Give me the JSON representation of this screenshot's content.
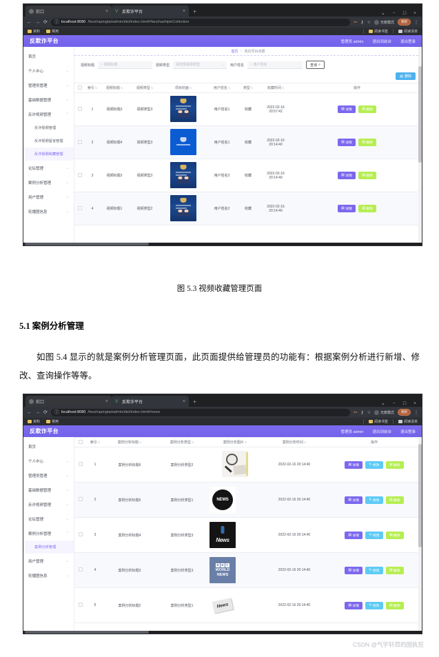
{
  "document": {
    "figure_caption_1": "图 5.3 视频收藏管理页面",
    "section_heading": "5.1 案例分析管理",
    "paragraph": "如图 5.4 显示的就是案例分析管理页面，此页面提供给管理员的功能有：根据案例分析进行新增、修改、查询操作等等。",
    "watermark": "CSDN @气宇轩昂的固执狂"
  },
  "browser": {
    "tabs": [
      {
        "label": "前口",
        "close": "×"
      },
      {
        "label": "反欺诈平台",
        "close": "×"
      }
    ],
    "new_tab": "+",
    "window_controls": {
      "minimize": "−",
      "maximize": "□",
      "close": "×",
      "chevron": "⌄"
    },
    "nav": {
      "back": "←",
      "forward": "→",
      "reload": "⟳",
      "info": "ⓘ"
    },
    "omni_right": {
      "star": "☆",
      "key": "⚷",
      "ext": "⚯",
      "incognito_label": "无痕模式",
      "update_label": "更新",
      "menu": "⋮"
    },
    "bookmarks": {
      "items": [
        "资料",
        "常用"
      ],
      "right_items": [
        "阅读书签",
        "阅读清单"
      ]
    }
  },
  "page1": {
    "url_host": "localhost:8080",
    "url_path": "/fanzhapingtai/admin/dist/index.html#/fanzhashipinCollection",
    "tab_title": "反欺诈平台",
    "header": {
      "logo": "反欺诈平台",
      "user": "管理员 admin",
      "to_front": "退出到前台",
      "logout": "退出登录"
    },
    "breadcrumb": {
      "home": "首页",
      "sep": "⌂",
      "current": "我的项目收藏"
    },
    "sidebar": [
      {
        "label": "首页",
        "expandable": false
      },
      {
        "label": "个人中心",
        "expandable": true
      },
      {
        "label": "管理员管理",
        "expandable": true
      },
      {
        "label": "基础数据管理",
        "expandable": true
      },
      {
        "label": "反诈视频管理",
        "expandable": true,
        "expanded": true,
        "children": [
          {
            "label": "反诈视频管理",
            "active": false
          },
          {
            "label": "反诈视频留言管理",
            "active": false
          },
          {
            "label": "反诈视频收藏管理",
            "active": true
          }
        ]
      },
      {
        "label": "论坛管理",
        "expandable": true
      },
      {
        "label": "案例分析管理",
        "expandable": true
      },
      {
        "label": "用户管理",
        "expandable": true
      },
      {
        "label": "轮播图信息",
        "expandable": true
      }
    ],
    "search": {
      "title_label": "视频标题",
      "title_placeholder": "视频标题",
      "type_label": "视频类型",
      "type_placeholder": "请选择视频类型",
      "user_label": "用户姓名",
      "user_placeholder": "用户姓名",
      "query_button": "查询"
    },
    "delete_button": "删除",
    "table": {
      "columns": [
        "索引",
        "视频标题",
        "视频类型",
        "项目封面",
        "用户姓名",
        "类型",
        "收藏时间",
        "操作"
      ],
      "rows": [
        {
          "index": "1",
          "title": "视频标题3",
          "type": "视频类型3",
          "cover": "v1",
          "user": "用户姓名1",
          "kind": "收藏",
          "time_line1": "2022-02-16",
          "time_line2": "20:57:42"
        },
        {
          "index": "2",
          "title": "视频标题4",
          "type": "视频类型3",
          "cover": "v2",
          "user": "用户姓名1",
          "kind": "收藏",
          "time_line1": "2022-02-16",
          "time_line2": "20:14:40"
        },
        {
          "index": "3",
          "title": "视频标题3",
          "type": "视频类型3",
          "cover": "v1",
          "user": "用户姓名3",
          "kind": "收藏",
          "time_line1": "2022-02-16",
          "time_line2": "20:14:40"
        },
        {
          "index": "4",
          "title": "视频标题1",
          "type": "视频类型2",
          "cover": "v1",
          "user": "用户姓名2",
          "kind": "收藏",
          "time_line1": "2022-02-16",
          "time_line2": "20:14:40"
        }
      ],
      "actions": {
        "detail": "详情",
        "delete": "删除"
      }
    }
  },
  "page2": {
    "url_host": "localhost:8080",
    "url_path": "/fanzhapingtai/admin/dist/index.html#/news",
    "tab_title": "反欺诈平台",
    "header": {
      "logo": "反欺诈平台",
      "user": "管理员 admin",
      "to_front": "退出到前台",
      "logout": "退出登录"
    },
    "sidebar": [
      {
        "label": "首页",
        "expandable": false
      },
      {
        "label": "个人中心",
        "expandable": true
      },
      {
        "label": "管理员管理",
        "expandable": true
      },
      {
        "label": "基础数据管理",
        "expandable": true
      },
      {
        "label": "反诈视频管理",
        "expandable": true
      },
      {
        "label": "论坛管理",
        "expandable": true
      },
      {
        "label": "案例分析管理",
        "expandable": true,
        "expanded": true,
        "children": [
          {
            "label": "案例分析管理",
            "active": true
          }
        ]
      },
      {
        "label": "用户管理",
        "expandable": true
      },
      {
        "label": "轮播图信息",
        "expandable": true
      }
    ],
    "table": {
      "columns": [
        "索引",
        "案例分析标题",
        "案例分析类型",
        "案例分析图片",
        "案例分析时间",
        "操作"
      ],
      "rows": [
        {
          "index": "1",
          "title": "案例分析标题6",
          "type": "案例分析类型2",
          "image": "n1",
          "time": "2022-02-16 20:14:40"
        },
        {
          "index": "2",
          "title": "案例分析标题5",
          "type": "案例分析类型1",
          "image": "n2",
          "time": "2022-02-16 20:14:40"
        },
        {
          "index": "3",
          "title": "案例分析标题4",
          "type": "案例分析类型3",
          "image": "n3",
          "time": "2022-02-16 20:14:40"
        },
        {
          "index": "4",
          "title": "案例分析标题3",
          "type": "案例分析类型3",
          "image": "n4",
          "time": "2022-02-16 20:14:40"
        },
        {
          "index": "5",
          "title": "案例分析标题2",
          "type": "案例分析类型1",
          "image": "n5",
          "time": "2022-02-16 20:14:40"
        }
      ],
      "actions": {
        "detail": "详情",
        "edit": "修改",
        "delete": "删除"
      }
    }
  },
  "colors": {
    "brand_purple": "#7b68ee",
    "edit_cyan": "#5ecbf5",
    "delete_green": "#b6ee52",
    "top_delete_blue": "#4fb2ef"
  },
  "icons": {
    "search": "⌕",
    "detail": "▤",
    "edit": "✎",
    "delete": "🗑"
  }
}
